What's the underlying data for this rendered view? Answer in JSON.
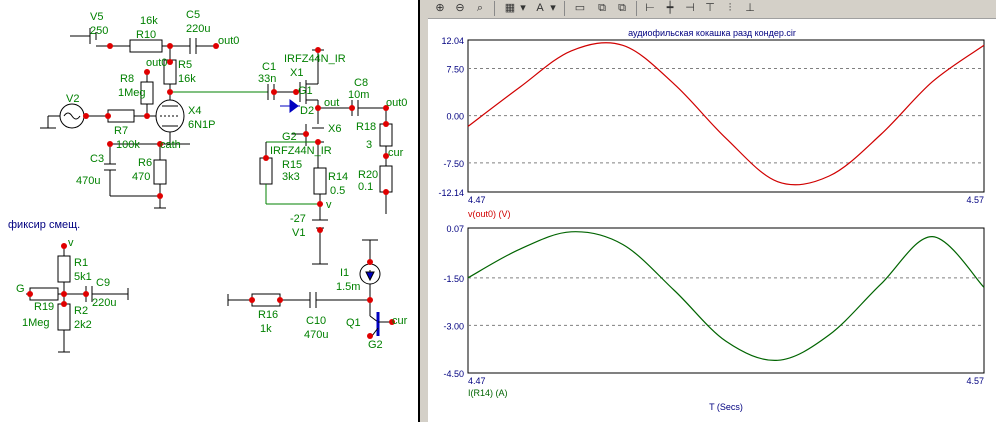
{
  "schematic": {
    "labels": {
      "v5_name": "V5",
      "v5_val": "250",
      "r10_val": "16k",
      "r10_name": "R10",
      "c5_name": "C5",
      "c5_val": "220u",
      "out0_a": "out0",
      "out0_b": "out0",
      "out0_c": "out0",
      "r5_name": "R5",
      "r5_val": "16k",
      "r8_name": "R8",
      "r8_val": "1Meg",
      "v2_name": "V2",
      "r7_name": "R7",
      "r7_val": "100k",
      "x4_name": "X4",
      "x4_val": "6N1P",
      "cath": "cath",
      "c3_name": "C3",
      "c3_val": "470u",
      "r6_name": "R6",
      "r6_val": "470",
      "c1_name": "C1",
      "c1_val": "33n",
      "x1_part": "IRFZ44N_IR",
      "x1_name": "X1",
      "g1": "G1",
      "d2": "D2",
      "out": "out",
      "c8_name": "C8",
      "c8_val": "10m",
      "r18_name": "R18",
      "r18_val": "3",
      "cur_a": "cur",
      "g2_a": "G2",
      "x6_name": "X6",
      "x6_part": "IRFZ44N_IR",
      "r15_name": "R15",
      "r15_val": "3k3",
      "r14_name": "R14",
      "r14_val": "0.5",
      "r20_name": "R20",
      "r20_val": "0.1",
      "v_a": "v",
      "v1_val": "-27",
      "v1_name": "V1",
      "fix_title": "фиксир смещ.",
      "v_b": "v",
      "r1_name": "R1",
      "r1_val": "5k1",
      "g_label": "G",
      "c9_name": "C9",
      "c9_val": "220u",
      "r19_name": "R19",
      "r19_val": "1Meg",
      "r2_name": "R2",
      "r2_val": "2k2",
      "i1_name": "I1",
      "i1_val": "1.5m",
      "r16_name": "R16",
      "r16_val": "1k",
      "c10_name": "C10",
      "c10_val": "470u",
      "q1_name": "Q1",
      "g2_b": "G2",
      "cur_b": "cur"
    }
  },
  "plot": {
    "title": "аудиофильская кокашка разд кондер.cir",
    "x_axis_label": "T (Secs)",
    "colors": {
      "top": "#d00000",
      "bottom": "#006400",
      "axis_text": "#000080",
      "grid": "#808080",
      "node": "#e00000",
      "wire": "#000000",
      "wire_green": "#008000",
      "text_blue": "#000080"
    },
    "toolbar_icons": [
      "zoom-in-icon",
      "zoom-out-icon",
      "zoom-fit-icon",
      "grid-icon",
      "dropdown-icon",
      "text-icon",
      "dropdown-icon",
      "window-icon",
      "tile-icon",
      "cascade-icon",
      "align-left-icon",
      "align-center-icon",
      "align-right-icon",
      "align-h-icon",
      "align-v-icon",
      "distribute-icon"
    ]
  },
  "chart_data": [
    {
      "type": "line",
      "title": "аудиофильская кокашка разд кондер.cir",
      "ylabel": "",
      "series": [
        {
          "name": "v(out0) (V)",
          "color": "#d00000",
          "x": [
            4.47,
            4.48,
            4.49,
            4.5,
            4.51,
            4.52,
            4.53,
            4.54,
            4.55,
            4.56,
            4.57
          ],
          "y": [
            -1.7,
            4.5,
            10.3,
            11.2,
            5.0,
            -3.6,
            -10.5,
            -9.6,
            -3.0,
            5.4,
            11.2
          ]
        }
      ],
      "xlim": [
        4.47,
        4.57
      ],
      "ylim": [
        -12.14,
        12.04
      ],
      "y_ticks": [
        "12.04",
        "7.50",
        "0.00",
        "-7.50",
        "-12.14"
      ],
      "x_ticks": [
        "4.47",
        "4.57"
      ],
      "grid": "dashed horizontal"
    },
    {
      "type": "line",
      "ylabel": "",
      "series": [
        {
          "name": "I(R14) (A)",
          "color": "#006400",
          "x": [
            4.47,
            4.48,
            4.49,
            4.5,
            4.51,
            4.52,
            4.53,
            4.54,
            4.55,
            4.56,
            4.57
          ],
          "y": [
            -1.5,
            -0.6,
            -0.05,
            -0.45,
            -1.9,
            -3.5,
            -4.1,
            -3.3,
            -1.7,
            -0.2,
            -1.8
          ]
        }
      ],
      "xlim": [
        4.47,
        4.57
      ],
      "ylim": [
        -4.5,
        0.07
      ],
      "y_ticks": [
        "0.07",
        "-1.50",
        "-3.00",
        "-4.50"
      ],
      "x_ticks": [
        "4.47",
        "4.57"
      ],
      "xlabel": "T (Secs)",
      "grid": "dashed horizontal"
    }
  ]
}
